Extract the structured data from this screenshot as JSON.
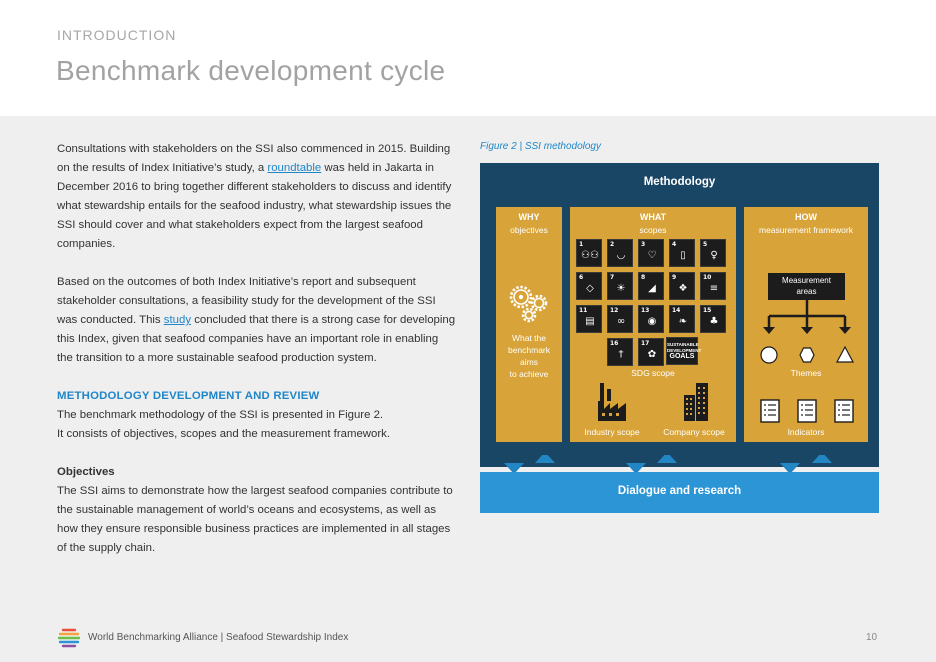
{
  "header": {
    "section": "INTRODUCTION",
    "title": "Benchmark development cycle"
  },
  "body": {
    "p1_pre": "Consultations with stakeholders on the SSI also commenced in 2015. Building on the results of Index Initiative’s study, a ",
    "p1_link": "roundtable",
    "p1_post": " was held in Jakarta in December 2016 to bring together different stakeholders to discuss and identify what stewardship entails for the seafood industry, what stewardship issues the SSI should cover and what stakeholders expect from the largest seafood companies.",
    "p2_pre": "Based on the outcomes of both Index Initiative’s report and subsequent stakeholder consultations, a feasibility study for the development of the SSI was conducted. This ",
    "p2_link": "study",
    "p2_post": " concluded that there is a strong case for developing this Index, given that seafood companies have an important role in enabling the transition to a more sustainable seafood production system.",
    "subheading": "METHODOLOGY DEVELOPMENT AND REVIEW",
    "p3_line1": "The benchmark methodology of the SSI is presented in Figure 2.",
    "p3_line2": "It consists of objectives, scopes and the measurement framework.",
    "objectives_heading": "Objectives",
    "p4": "The SSI aims to demonstrate how the largest seafood companies contribute to the sustainable management of world’s oceans and ecosystems, as well as how they ensure responsible business practices are implemented in all stages of the supply chain."
  },
  "figure": {
    "caption": "Figure 2 | SSI methodology",
    "title": "Methodology",
    "why": {
      "head": "WHY",
      "sub": "objectives",
      "text_1": "What the",
      "text_2": "benchmark",
      "text_3": "aims",
      "text_4": "to achieve"
    },
    "what": {
      "head": "WHAT",
      "sub": "scopes",
      "sdg_scope": "SDG scope",
      "industry_scope": "Industry scope",
      "company_scope": "Company scope"
    },
    "how": {
      "head": "HOW",
      "sub": "measurement framework",
      "measurement_1": "Measurement",
      "measurement_2": "areas",
      "themes": "Themes",
      "indicators": "Indicators"
    },
    "dialogue": "Dialogue and research",
    "sdg_tiles": [
      {
        "num": "1",
        "icon": "people"
      },
      {
        "num": "2",
        "icon": "bowl"
      },
      {
        "num": "3",
        "icon": "heartbeat"
      },
      {
        "num": "4",
        "icon": "book"
      },
      {
        "num": "5",
        "icon": "gender"
      },
      {
        "num": "6",
        "icon": "water"
      },
      {
        "num": "7",
        "icon": "sun"
      },
      {
        "num": "8",
        "icon": "growth"
      },
      {
        "num": "9",
        "icon": "cubes"
      },
      {
        "num": "10",
        "icon": "equal"
      },
      {
        "num": "11",
        "icon": "city"
      },
      {
        "num": "12",
        "icon": "infinity"
      },
      {
        "num": "13",
        "icon": "eye"
      },
      {
        "num": "14",
        "icon": "fish"
      },
      {
        "num": "15",
        "icon": "tree"
      },
      {
        "num": "16",
        "icon": "dove"
      },
      {
        "num": "17",
        "icon": "flower"
      }
    ],
    "sdg_goals_1": "SUSTAINABLE",
    "sdg_goals_2": "DEVELOPMENT",
    "sdg_goals_3": "GOALS",
    "colors": {
      "dark": "#1a4666",
      "gold": "#d8a338",
      "blue": "#2b95d6"
    }
  },
  "footer": {
    "text": "World Benchmarking Alliance | Seafood Stewardship Index",
    "page": "10"
  }
}
